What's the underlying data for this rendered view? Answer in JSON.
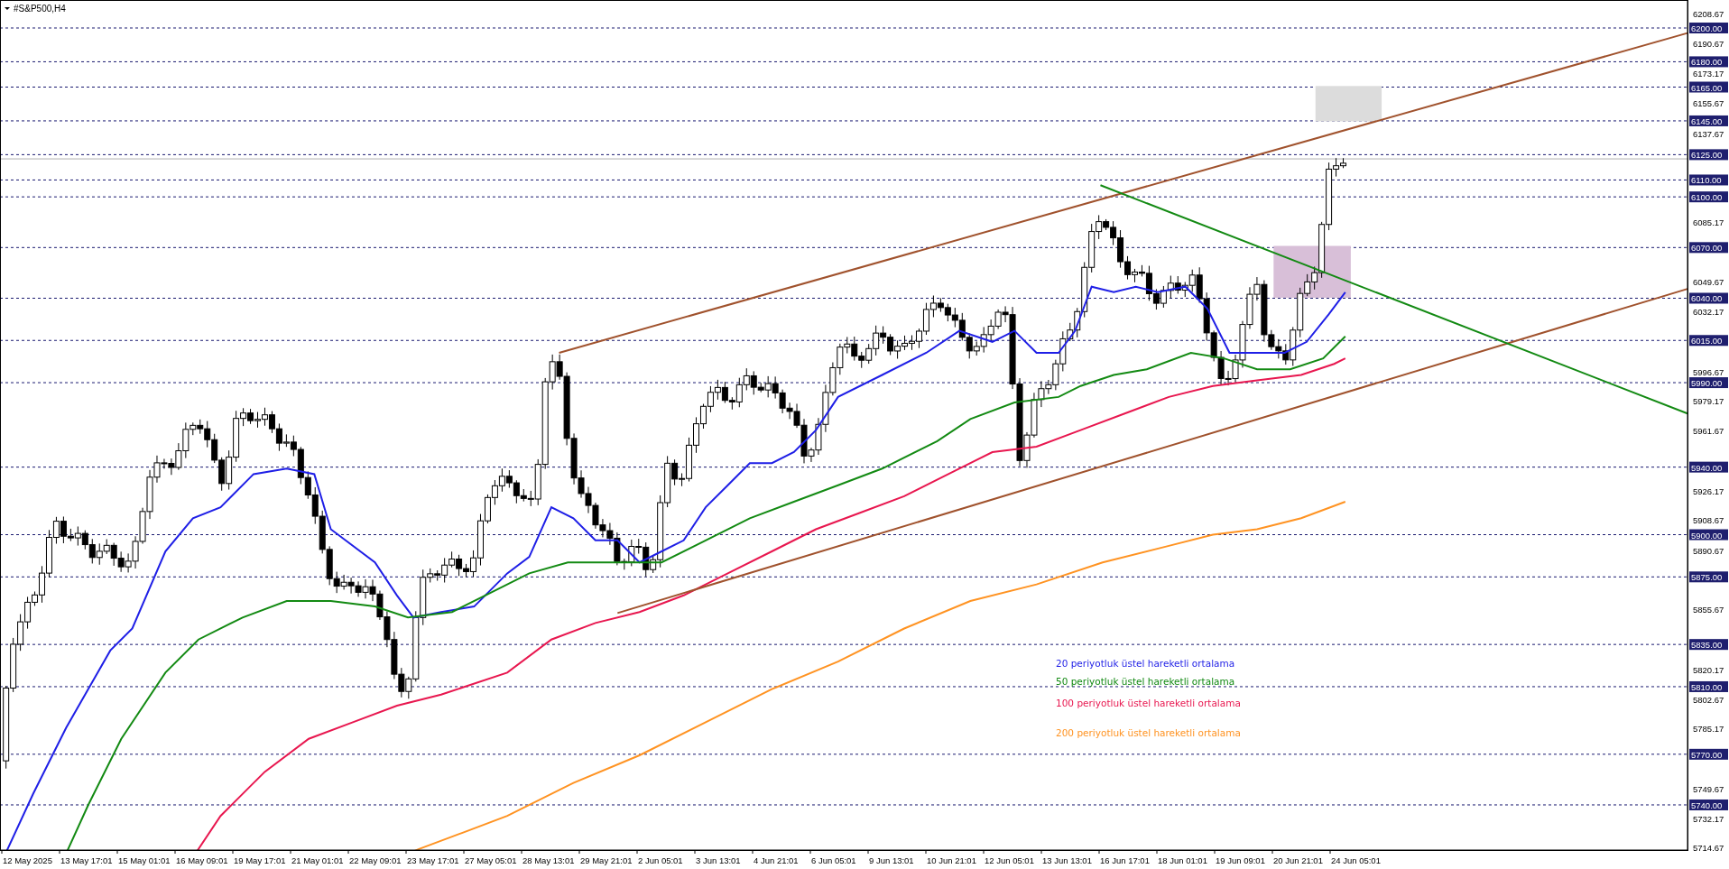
{
  "chart": {
    "title": "#S&P500,H4",
    "price_axis": {
      "labels": [
        {
          "text": "6208.67",
          "kind": "tick"
        },
        {
          "text": "6200.00",
          "kind": "level"
        },
        {
          "text": "6190.67",
          "kind": "tick"
        },
        {
          "text": "6180.00",
          "kind": "level"
        },
        {
          "text": "6173.17",
          "kind": "tick"
        },
        {
          "text": "6165.00",
          "kind": "level"
        },
        {
          "text": "6155.67",
          "kind": "tick"
        },
        {
          "text": "6145.00",
          "kind": "level"
        },
        {
          "text": "6137.67",
          "kind": "tick"
        },
        {
          "text": "6125.00",
          "kind": "level"
        },
        {
          "text": "6110.00",
          "kind": "level"
        },
        {
          "text": "6100.00",
          "kind": "level"
        },
        {
          "text": "6085.17",
          "kind": "tick"
        },
        {
          "text": "6070.00",
          "kind": "level"
        },
        {
          "text": "6049.67",
          "kind": "tick"
        },
        {
          "text": "6040.00",
          "kind": "level"
        },
        {
          "text": "6032.17",
          "kind": "tick"
        },
        {
          "text": "6015.00",
          "kind": "level"
        },
        {
          "text": "5996.67",
          "kind": "tick"
        },
        {
          "text": "5990.00",
          "kind": "level"
        },
        {
          "text": "5979.17",
          "kind": "tick"
        },
        {
          "text": "5961.67",
          "kind": "tick"
        },
        {
          "text": "5940.00",
          "kind": "level"
        },
        {
          "text": "5926.17",
          "kind": "tick"
        },
        {
          "text": "5908.67",
          "kind": "tick"
        },
        {
          "text": "5900.00",
          "kind": "level"
        },
        {
          "text": "5890.67",
          "kind": "tick"
        },
        {
          "text": "5875.00",
          "kind": "level"
        },
        {
          "text": "5855.67",
          "kind": "tick"
        },
        {
          "text": "5835.00",
          "kind": "level"
        },
        {
          "text": "5820.17",
          "kind": "tick"
        },
        {
          "text": "5810.00",
          "kind": "level"
        },
        {
          "text": "5802.67",
          "kind": "tick"
        },
        {
          "text": "5785.17",
          "kind": "tick"
        },
        {
          "text": "5770.00",
          "kind": "level"
        },
        {
          "text": "5749.67",
          "kind": "tick"
        },
        {
          "text": "5740.00",
          "kind": "level"
        },
        {
          "text": "5732.17",
          "kind": "tick"
        },
        {
          "text": "5714.67",
          "kind": "tick"
        }
      ]
    },
    "time_axis": {
      "labels": [
        "12 May 2025",
        "13 May 17:01",
        "15 May 01:01",
        "16 May 09:01",
        "19 May 17:01",
        "21 May 01:01",
        "22 May 09:01",
        "23 May 17:01",
        "27 May 05:01",
        "28 May 13:01",
        "29 May 21:01",
        "2 Jun 05:01",
        "3 Jun 13:01",
        "4 Jun 21:01",
        "6 Jun 05:01",
        "9 Jun 13:01",
        "10 Jun 21:01",
        "12 Jun 05:01",
        "13 Jun 13:01",
        "16 Jun 17:01",
        "18 Jun 01:01",
        "19 Jun 09:01",
        "20 Jun 21:01",
        "24 Jun 05:01"
      ]
    },
    "legend": [
      {
        "text": "20 periyotluk üstel hareketli ortalama",
        "color": "#1f1fe6"
      },
      {
        "text": "50 periyotluk üstel hareketli ortalama",
        "color": "#138a13"
      },
      {
        "text": "100 periyotluk üstel hareketli ortalama",
        "color": "#e8174f"
      },
      {
        "text": "200 periyotluk üstel hareketli ortalama",
        "color": "#ff9322"
      }
    ]
  }
}
